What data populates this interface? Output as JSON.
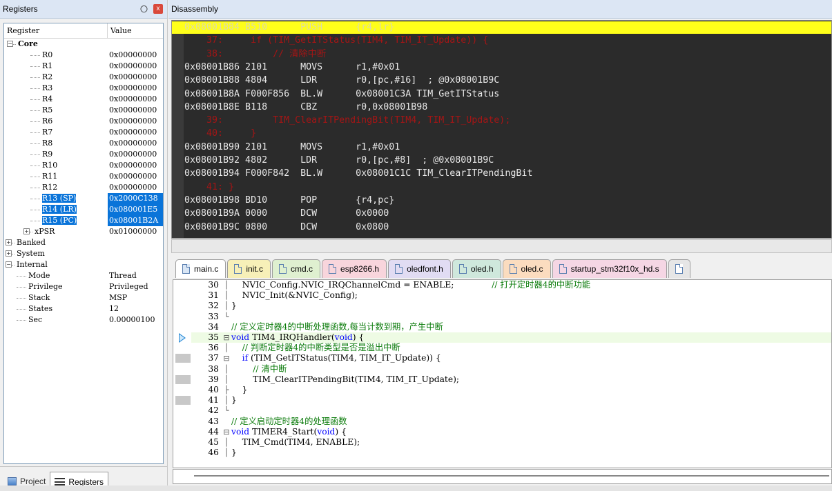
{
  "registers_panel": {
    "title": "Registers",
    "pin_glyph": "〇",
    "close_glyph": "x",
    "header": {
      "col_register": "Register",
      "col_value": "Value"
    },
    "core": {
      "label": "Core",
      "regs": [
        {
          "name": "R0",
          "value": "0x00000000"
        },
        {
          "name": "R1",
          "value": "0x00000000"
        },
        {
          "name": "R2",
          "value": "0x00000000"
        },
        {
          "name": "R3",
          "value": "0x00000000"
        },
        {
          "name": "R4",
          "value": "0x00000000"
        },
        {
          "name": "R5",
          "value": "0x00000000"
        },
        {
          "name": "R6",
          "value": "0x00000000"
        },
        {
          "name": "R7",
          "value": "0x00000000"
        },
        {
          "name": "R8",
          "value": "0x00000000"
        },
        {
          "name": "R9",
          "value": "0x00000000"
        },
        {
          "name": "R10",
          "value": "0x00000000"
        },
        {
          "name": "R11",
          "value": "0x00000000"
        },
        {
          "name": "R12",
          "value": "0x00000000"
        },
        {
          "name": "R13 (SP)",
          "value": "0x2000C138"
        },
        {
          "name": "R14 (LR)",
          "value": "0x080001E5"
        },
        {
          "name": "R15 (PC)",
          "value": "0x08001B2A"
        },
        {
          "name": "xPSR",
          "value": "0x01000000"
        }
      ]
    },
    "banked": "Banked",
    "system": "System",
    "internal": {
      "label": "Internal",
      "items": [
        {
          "name": "Mode",
          "value": "Thread"
        },
        {
          "name": "Privilege",
          "value": "Privileged"
        },
        {
          "name": "Stack",
          "value": "MSP"
        },
        {
          "name": "States",
          "value": "12"
        },
        {
          "name": "Sec",
          "value": "0.00000100"
        }
      ]
    },
    "tabs": {
      "project": "Project",
      "registers": "Registers"
    }
  },
  "disassembly": {
    "title": "Disassembly",
    "lines": [
      {
        "type": "cur",
        "text": "0x08001B84 B510      PUSH      {r4,lr}"
      },
      {
        "type": "src",
        "text": "    37:     if (TIM_GetITStatus(TIM4, TIM_IT_Update)) {"
      },
      {
        "type": "src",
        "text": "    38:         // 清除中断"
      },
      {
        "type": "asm",
        "text": "0x08001B86 2101      MOVS      r1,#0x01"
      },
      {
        "type": "asm",
        "text": "0x08001B88 4804      LDR       r0,[pc,#16]  ; @0x08001B9C"
      },
      {
        "type": "asm",
        "text": "0x08001B8A F000F856  BL.W      0x08001C3A TIM_GetITStatus"
      },
      {
        "type": "asm",
        "text": "0x08001B8E B118      CBZ       r0,0x08001B98"
      },
      {
        "type": "src",
        "text": "    39:         TIM_ClearITPendingBit(TIM4, TIM_IT_Update);"
      },
      {
        "type": "src",
        "text": "    40:     }"
      },
      {
        "type": "asm",
        "text": "0x08001B90 2101      MOVS      r1,#0x01"
      },
      {
        "type": "asm",
        "text": "0x08001B92 4802      LDR       r0,[pc,#8]  ; @0x08001B9C"
      },
      {
        "type": "asm",
        "text": "0x08001B94 F000F842  BL.W      0x08001C1C TIM_ClearITPendingBit"
      },
      {
        "type": "src",
        "text": "    41: }"
      },
      {
        "type": "asm",
        "text": "0x08001B98 BD10      POP       {r4,pc}"
      },
      {
        "type": "asm",
        "text": "0x08001B9A 0000      DCW       0x0000"
      },
      {
        "type": "asm",
        "text": "0x08001B9C 0800      DCW       0x0800"
      }
    ]
  },
  "editor": {
    "tabs": [
      {
        "label": "main.c",
        "color": "#d9e6f5"
      },
      {
        "label": "init.c",
        "color": "#f7f0b8"
      },
      {
        "label": "cmd.c",
        "color": "#dff0d0"
      },
      {
        "label": "esp8266.h",
        "color": "#f8d5dc"
      },
      {
        "label": "oledfont.h",
        "color": "#e1dcf3"
      },
      {
        "label": "oled.h",
        "color": "#cfe8dc"
      },
      {
        "label": "oled.c",
        "color": "#fbdcbf"
      },
      {
        "label": "startup_stm32f10x_hd.s",
        "color": "#f5d6e4"
      }
    ],
    "lines": [
      {
        "n": "30",
        "fold": "│",
        "html": "    NVIC_Config.NVIC_IRQChannelCmd = ENABLE;              <span class=\"cm\">// 打开定时器4的中断功能</span>"
      },
      {
        "n": "31",
        "fold": "│",
        "html": "    NVIC_Init(&amp;NVIC_Config);"
      },
      {
        "n": "32",
        "fold": "│",
        "html": "}"
      },
      {
        "n": "33",
        "fold": "└",
        "html": ""
      },
      {
        "n": "34",
        "fold": "",
        "html": "<span class=\"cm\">// 定义定时器4的中断处理函数,每当计数到期，产生中断</span>"
      },
      {
        "n": "35",
        "fold": "⊟",
        "html": "<span class=\"kw\">void</span> TIM4_IRQHandler(<span class=\"kw\">void</span>) {",
        "cur": true
      },
      {
        "n": "36",
        "fold": "│",
        "html": "    <span class=\"cm\">// 判断定时器4的中断类型是否是溢出中断</span>"
      },
      {
        "n": "37",
        "fold": "⊟",
        "html": "    <span class=\"kw\">if</span> (TIM_GetITStatus(TIM4, TIM_IT_Update)) {"
      },
      {
        "n": "38",
        "fold": "│",
        "html": "        <span class=\"cm\">// 清中断</span>"
      },
      {
        "n": "39",
        "fold": "│",
        "html": "        TIM_ClearITPendingBit(TIM4, TIM_IT_Update);"
      },
      {
        "n": "40",
        "fold": "├",
        "html": "    }"
      },
      {
        "n": "41",
        "fold": "│",
        "html": "}"
      },
      {
        "n": "42",
        "fold": "└",
        "html": ""
      },
      {
        "n": "43",
        "fold": "",
        "html": "<span class=\"cm\">// 定义启动定时器4的处理函数</span>"
      },
      {
        "n": "44",
        "fold": "⊟",
        "html": "<span class=\"kw\">void</span> TIMER4_Start(<span class=\"kw\">void</span>) {"
      },
      {
        "n": "45",
        "fold": "│",
        "html": "    TIM_Cmd(TIM4, ENABLE);"
      },
      {
        "n": "46",
        "fold": "│",
        "html": "}"
      }
    ],
    "gutter_marks": [
      "35",
      "37",
      "39",
      "41"
    ]
  }
}
